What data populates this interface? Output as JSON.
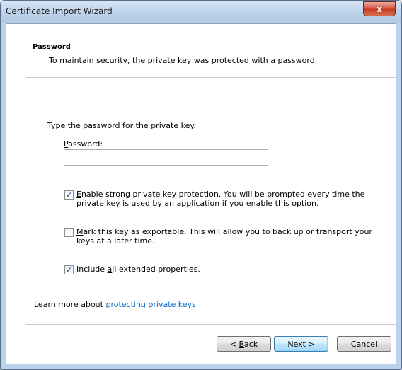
{
  "window": {
    "title": "Certificate Import Wizard",
    "close_glyph": "x"
  },
  "header": {
    "title": "Password",
    "description": "To maintain security, the private key was protected with a password."
  },
  "body": {
    "prompt": "Type the password for the private key.",
    "password_label_accel": "P",
    "password_label_rest": "assword:",
    "password_value": ""
  },
  "options": [
    {
      "checked": true,
      "accel": "E",
      "line1_rest": "nable strong private key protection. You will be prompted every time the",
      "line2": "private key is used by an application if you enable this option."
    },
    {
      "checked": false,
      "accel": "M",
      "line1_rest": "ark this key as exportable. This will allow you to back up or transport your",
      "line2": "keys at a later time."
    },
    {
      "checked": true,
      "pre": "Include ",
      "accel": "a",
      "post": "ll extended properties."
    }
  ],
  "learn": {
    "prefix": "Learn more about ",
    "link": "protecting private keys"
  },
  "buttons": {
    "back_pre": "< ",
    "back_accel": "B",
    "back_post": "ack",
    "next": "Next >",
    "cancel": "Cancel"
  },
  "colors": {
    "link": "#0066cc",
    "title_bar": "#bdd2ea",
    "close_button": "#c23a22",
    "default_button_border": "#3c7fb1"
  }
}
